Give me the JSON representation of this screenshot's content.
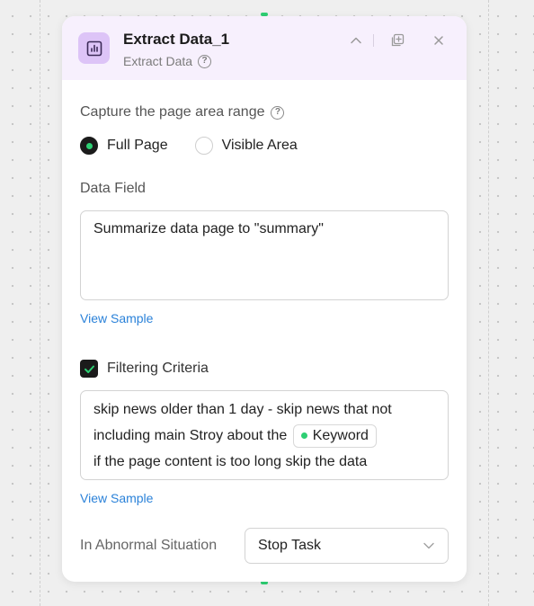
{
  "node": {
    "title": "Extract Data_1",
    "subtitle": "Extract Data"
  },
  "capture": {
    "label": "Capture the page area range",
    "options": [
      {
        "label": "Full Page",
        "selected": true
      },
      {
        "label": "Visible Area",
        "selected": false
      }
    ]
  },
  "data_field": {
    "label": "Data Field",
    "value": "Summarize data page to \"summary\"",
    "view_sample": "View Sample"
  },
  "filtering": {
    "label": "Filtering Criteria",
    "checked": true,
    "line1": "skip news older than 1 day - skip news that not",
    "line2_prefix": "including main Stroy about the",
    "keyword_chip": "Keyword",
    "line3": "if the page content is too long skip the data",
    "view_sample": "View Sample"
  },
  "abnormal": {
    "label": "In Abnormal Situation",
    "value": "Stop Task"
  },
  "colors": {
    "accent_green": "#2dcf73",
    "header_bg": "#f7f0fd",
    "icon_bg": "#ddc4f7",
    "link": "#2b82d9"
  },
  "icons": {
    "node": "chart-icon",
    "collapse": "chevron-up-icon",
    "copy": "duplicate-icon",
    "close": "close-icon",
    "help": "help-icon",
    "dropdown": "chevron-down-icon"
  }
}
